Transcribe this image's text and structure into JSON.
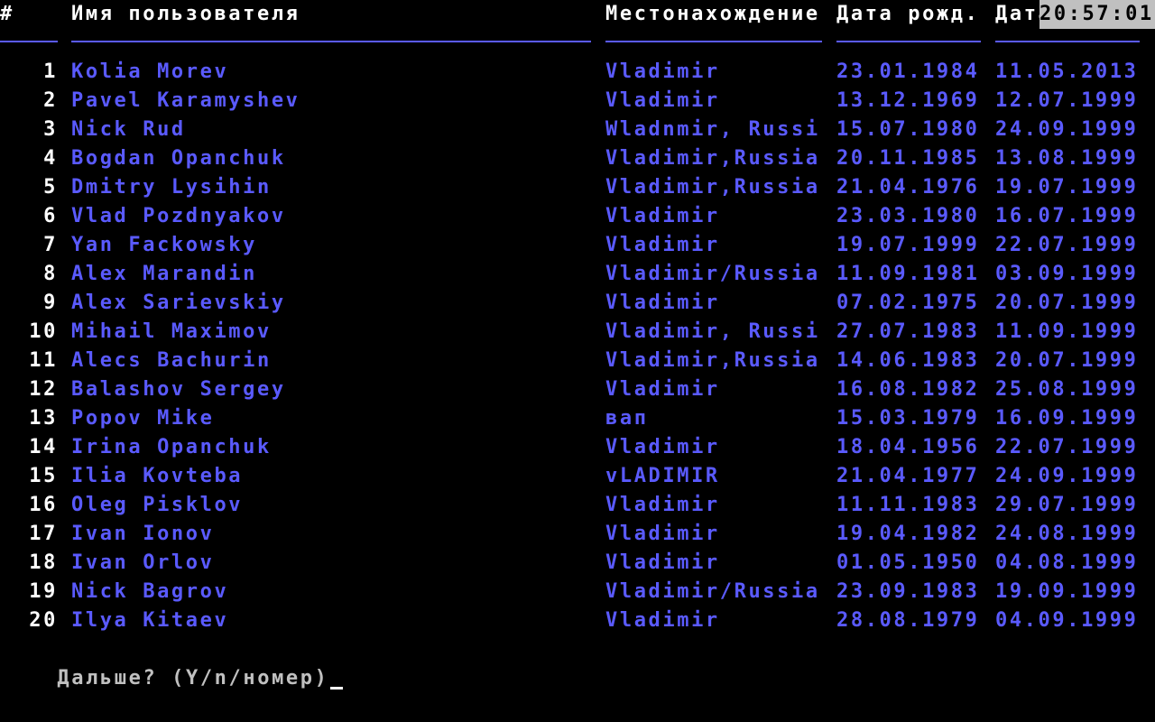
{
  "header": {
    "num": "#",
    "name": "Имя пользователя",
    "location": "Местонахождение",
    "birth": "Дата рожд.",
    "date": "Дата регистр."
  },
  "clock": "20:57:01",
  "rows": [
    {
      "num": "1",
      "name": "Kolia Morev",
      "location": "Vladimir",
      "birth": "23.01.1984",
      "date": "11.05.2013"
    },
    {
      "num": "2",
      "name": "Pavel Karamyshev",
      "location": "Vladimir",
      "birth": "13.12.1969",
      "date": "12.07.1999"
    },
    {
      "num": "3",
      "name": "Nick Rud",
      "location": "Wladnmir, Russi",
      "birth": "15.07.1980",
      "date": "24.09.1999"
    },
    {
      "num": "4",
      "name": "Bogdan Opanchuk",
      "location": "Vladimir,Russia",
      "birth": "20.11.1985",
      "date": "13.08.1999"
    },
    {
      "num": "5",
      "name": "Dmitry Lysihin",
      "location": "Vladimir,Russia",
      "birth": "21.04.1976",
      "date": "19.07.1999"
    },
    {
      "num": "6",
      "name": "Vlad Pozdnyakov",
      "location": "Vladimir",
      "birth": "23.03.1980",
      "date": "16.07.1999"
    },
    {
      "num": "7",
      "name": "Yan Fackowsky",
      "location": "Vladimir",
      "birth": "19.07.1999",
      "date": "22.07.1999"
    },
    {
      "num": "8",
      "name": "Alex Marandin",
      "location": "Vladimir/Russia",
      "birth": "11.09.1981",
      "date": "03.09.1999"
    },
    {
      "num": "9",
      "name": "Alex Sarievskiy",
      "location": "Vladimir",
      "birth": "07.02.1975",
      "date": "20.07.1999"
    },
    {
      "num": "10",
      "name": "Mihail Maximov",
      "location": "Vladimir, Russi",
      "birth": "27.07.1983",
      "date": "11.09.1999"
    },
    {
      "num": "11",
      "name": "Alecs Bachurin",
      "location": "Vladimir,Russia",
      "birth": "14.06.1983",
      "date": "20.07.1999"
    },
    {
      "num": "12",
      "name": "Balashov Sergey",
      "location": "Vladimir",
      "birth": "16.08.1982",
      "date": "25.08.1999"
    },
    {
      "num": "13",
      "name": "Popov Mike",
      "location": "вап",
      "birth": "15.03.1979",
      "date": "16.09.1999"
    },
    {
      "num": "14",
      "name": "Irina Opanchuk",
      "location": "Vladimir",
      "birth": "18.04.1956",
      "date": "22.07.1999"
    },
    {
      "num": "15",
      "name": "Ilia Kovteba",
      "location": "vLADIMIR",
      "birth": "21.04.1977",
      "date": "24.09.1999"
    },
    {
      "num": "16",
      "name": "Oleg Pisklov",
      "location": "Vladimir",
      "birth": "11.11.1983",
      "date": "29.07.1999"
    },
    {
      "num": "17",
      "name": "Ivan Ionov",
      "location": "Vladimir",
      "birth": "19.04.1982",
      "date": "24.08.1999"
    },
    {
      "num": "18",
      "name": "Ivan Orlov",
      "location": "Vladimir",
      "birth": "01.05.1950",
      "date": "04.08.1999"
    },
    {
      "num": "19",
      "name": "Nick Bagrov",
      "location": "Vladimir/Russia",
      "birth": "23.09.1983",
      "date": "19.09.1999"
    },
    {
      "num": "20",
      "name": "Ilya Kitaev",
      "location": "Vladimir",
      "birth": "28.08.1979",
      "date": "04.09.1999"
    }
  ],
  "prompt": {
    "text": "Дальше? (Y/n/номер)"
  },
  "colors": {
    "background": "#000000",
    "text_blue": "#5a5aff",
    "text_white": "#ffffff",
    "clock_bg": "#c0c0c0",
    "clock_fg": "#000000"
  }
}
